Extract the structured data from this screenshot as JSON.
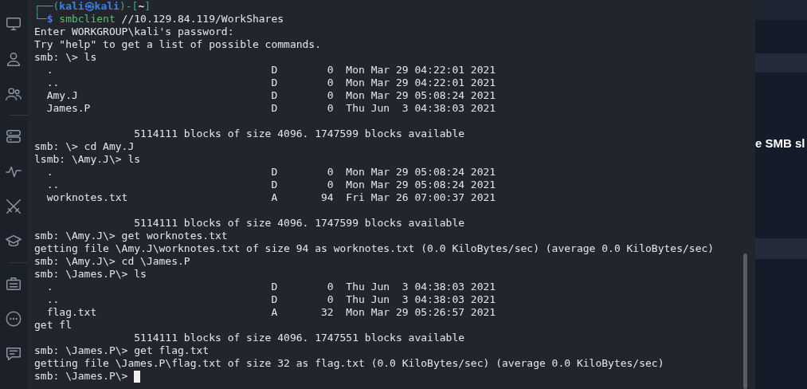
{
  "terminal": {
    "lines": [
      {
        "segments": [
          {
            "kind": "frame",
            "text": "┌──("
          },
          {
            "kind": "user",
            "text": "kali㉿kali"
          },
          {
            "kind": "frame",
            "text": ")-["
          },
          {
            "kind": "dir",
            "text": "~"
          },
          {
            "kind": "frame",
            "text": "]"
          }
        ]
      },
      {
        "segments": [
          {
            "kind": "frame",
            "text": "└─"
          },
          {
            "kind": "user",
            "text": "$ "
          },
          {
            "kind": "command",
            "text": "smbclient"
          },
          {
            "kind": "plain",
            "text": " //10.129.84.119/WorkShares"
          }
        ]
      },
      {
        "segments": [
          {
            "kind": "plain",
            "text": "Enter WORKGROUP\\kali's password:"
          }
        ]
      },
      {
        "segments": [
          {
            "kind": "plain",
            "text": "Try \"help\" to get a list of possible commands."
          }
        ]
      },
      {
        "segments": [
          {
            "kind": "plain",
            "text": "smb: \\> ls"
          }
        ]
      },
      {
        "segments": [
          {
            "kind": "plain",
            "text": "  .                                   D        0  Mon Mar 29 04:22:01 2021"
          }
        ]
      },
      {
        "segments": [
          {
            "kind": "plain",
            "text": "  ..                                  D        0  Mon Mar 29 04:22:01 2021"
          }
        ]
      },
      {
        "segments": [
          {
            "kind": "plain",
            "text": "  Amy.J                               D        0  Mon Mar 29 05:08:24 2021"
          }
        ]
      },
      {
        "segments": [
          {
            "kind": "plain",
            "text": "  James.P                             D        0  Thu Jun  3 04:38:03 2021"
          }
        ]
      },
      {
        "kind": "blank"
      },
      {
        "segments": [
          {
            "kind": "plain",
            "text": "                5114111 blocks of size 4096. 1747599 blocks available"
          }
        ]
      },
      {
        "segments": [
          {
            "kind": "plain",
            "text": "smb: \\> cd Amy.J"
          }
        ]
      },
      {
        "segments": [
          {
            "kind": "plain",
            "text": "lsmb: \\Amy.J\\> ls"
          }
        ]
      },
      {
        "segments": [
          {
            "kind": "plain",
            "text": "  .                                   D        0  Mon Mar 29 05:08:24 2021"
          }
        ]
      },
      {
        "segments": [
          {
            "kind": "plain",
            "text": "  ..                                  D        0  Mon Mar 29 05:08:24 2021"
          }
        ]
      },
      {
        "segments": [
          {
            "kind": "plain",
            "text": "  worknotes.txt                       A       94  Fri Mar 26 07:00:37 2021"
          }
        ]
      },
      {
        "kind": "blank"
      },
      {
        "segments": [
          {
            "kind": "plain",
            "text": "                5114111 blocks of size 4096. 1747599 blocks available"
          }
        ]
      },
      {
        "segments": [
          {
            "kind": "plain",
            "text": "smb: \\Amy.J\\> get worknotes.txt"
          }
        ]
      },
      {
        "segments": [
          {
            "kind": "plain",
            "text": "getting file \\Amy.J\\worknotes.txt of size 94 as worknotes.txt (0.0 KiloBytes/sec) (average 0.0 KiloBytes/sec)"
          }
        ]
      },
      {
        "segments": [
          {
            "kind": "plain",
            "text": "smb: \\Amy.J\\> cd \\James.P"
          }
        ]
      },
      {
        "segments": [
          {
            "kind": "plain",
            "text": "smb: \\James.P\\> ls"
          }
        ]
      },
      {
        "segments": [
          {
            "kind": "plain",
            "text": "  .                                   D        0  Thu Jun  3 04:38:03 2021"
          }
        ]
      },
      {
        "segments": [
          {
            "kind": "plain",
            "text": "  ..                                  D        0  Thu Jun  3 04:38:03 2021"
          }
        ]
      },
      {
        "segments": [
          {
            "kind": "plain",
            "text": "  flag.txt                            A       32  Mon Mar 29 05:26:57 2021"
          }
        ]
      },
      {
        "segments": [
          {
            "kind": "plain",
            "text": "get fl"
          }
        ]
      },
      {
        "segments": [
          {
            "kind": "plain",
            "text": "                5114111 blocks of size 4096. 1747551 blocks available"
          }
        ]
      },
      {
        "segments": [
          {
            "kind": "plain",
            "text": "smb: \\James.P\\> get flag.txt"
          }
        ]
      },
      {
        "segments": [
          {
            "kind": "plain",
            "text": "getting file \\James.P\\flag.txt of size 32 as flag.txt (0.0 KiloBytes/sec) (average 0.0 KiloBytes/sec)"
          }
        ]
      },
      {
        "segments": [
          {
            "kind": "plain",
            "text": "smb: \\James.P\\> "
          }
        ],
        "cursor": true
      }
    ]
  },
  "page": {
    "question_fragment": "e SMB sl"
  }
}
